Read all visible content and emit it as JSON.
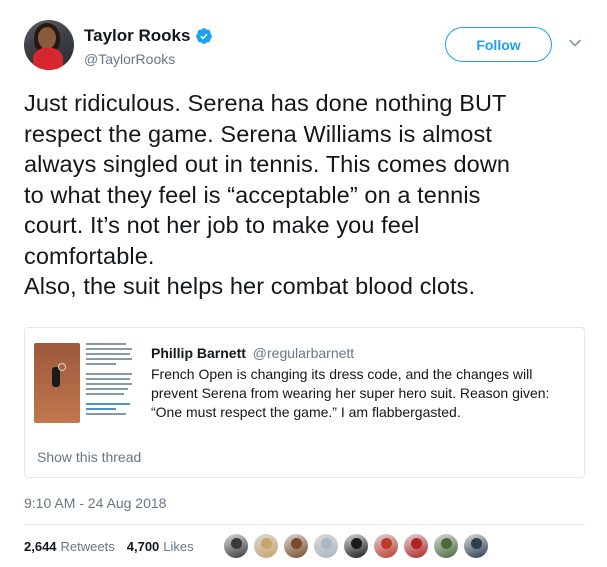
{
  "author": {
    "display_name": "Taylor Rooks",
    "handle": "@TaylorRooks",
    "verified": true,
    "verified_icon": "verified-badge-icon",
    "verified_color": "#1da1f2"
  },
  "actions": {
    "follow_label": "Follow",
    "menu_icon": "chevron-down-icon"
  },
  "tweet": {
    "lines": [
      "Just ridiculous. Serena has done nothing BUT",
      "respect the game. Serena Williams is almost",
      "always singled out in tennis. This comes down",
      "to what they feel is “acceptable” on a tennis",
      "court. It’s not her job to make you feel",
      "comfortable.",
      "Also, the suit helps her combat blood clots."
    ]
  },
  "quote": {
    "name": "Phillip Barnett",
    "handle": "@regularbarnett",
    "text": "French Open is changing its dress code, and the changes will prevent Serena from wearing her super hero suit. Reason given: “One must respect the game.” I am flabbergasted.",
    "show_thread": "Show this thread"
  },
  "meta": {
    "timestamp": "9:10 AM - 24 Aug 2018"
  },
  "stats": {
    "retweets_count": "2,644",
    "retweets_label": "Retweets",
    "likes_count": "4,700",
    "likes_label": "Likes"
  },
  "likers_colors": [
    "#3a3a3a",
    "#c9a46a",
    "#7a4a2a",
    "#aab8c2",
    "#1a1a1a",
    "#c0392b",
    "#b22222",
    "#4a6b3a",
    "#2c3e50"
  ],
  "colors": {
    "accent": "#1da1f2",
    "text": "#14171a",
    "muted": "#657786",
    "border": "#e1e8ed"
  }
}
